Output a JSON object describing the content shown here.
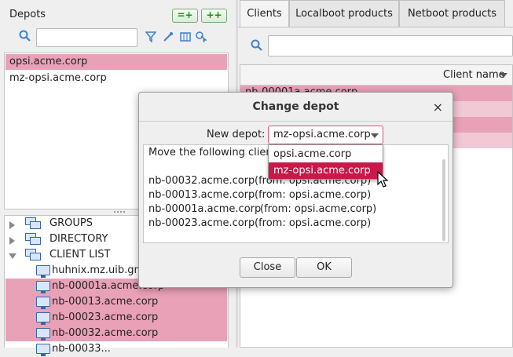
{
  "depots_panel": {
    "title": "Depots",
    "add_button_label": "=+",
    "add_all_button_label": "++",
    "search_placeholder": "",
    "depots": [
      "opsi.acme.corp",
      "mz-opsi.acme.corp"
    ],
    "selected_depot": "opsi.acme.corp"
  },
  "tree": {
    "groups_label": "GROUPS",
    "directory_label": "DIRECTORY",
    "client_list_label": "CLIENT LIST",
    "clients": [
      "huhnix.mz.uib.gmbh",
      "nb-00001a.acme.corp",
      "nb-00013.acme.corp",
      "nb-00023.acme.corp",
      "nb-00032.acme.corp",
      "nb-00033..."
    ]
  },
  "tabs": [
    "Clients",
    "Localboot products",
    "Netboot products"
  ],
  "client_table": {
    "column_header": "Client name",
    "visible_cell": "nb-00001a.acme.corp"
  },
  "dialog": {
    "title": "Change depot",
    "close_glyph": "×",
    "new_depot_label": "New depot:",
    "new_depot_value": "mz-opsi.acme.corp",
    "dropdown_options": [
      "opsi.acme.corp",
      "mz-opsi.acme.corp"
    ],
    "message_intro": "Move the following clients",
    "moves": [
      {
        "client": "nb-00032.acme.corp",
        "from": "(from: opsi.acme.corp)"
      },
      {
        "client": "nb-00013.acme.corp",
        "from": "(from: opsi.acme.corp)"
      },
      {
        "client": "nb-00001a.acme.corp",
        "from": "(from: opsi.acme.corp)"
      },
      {
        "client": "nb-00023.acme.corp",
        "from": "(from: opsi.acme.corp)"
      }
    ],
    "close_button": "Close",
    "ok_button": "OK"
  },
  "colors": {
    "selection": "#e9a1b8",
    "highlight": "#c9184a",
    "add_green": "#1c8a1c",
    "icon_blue": "#3567a8"
  }
}
